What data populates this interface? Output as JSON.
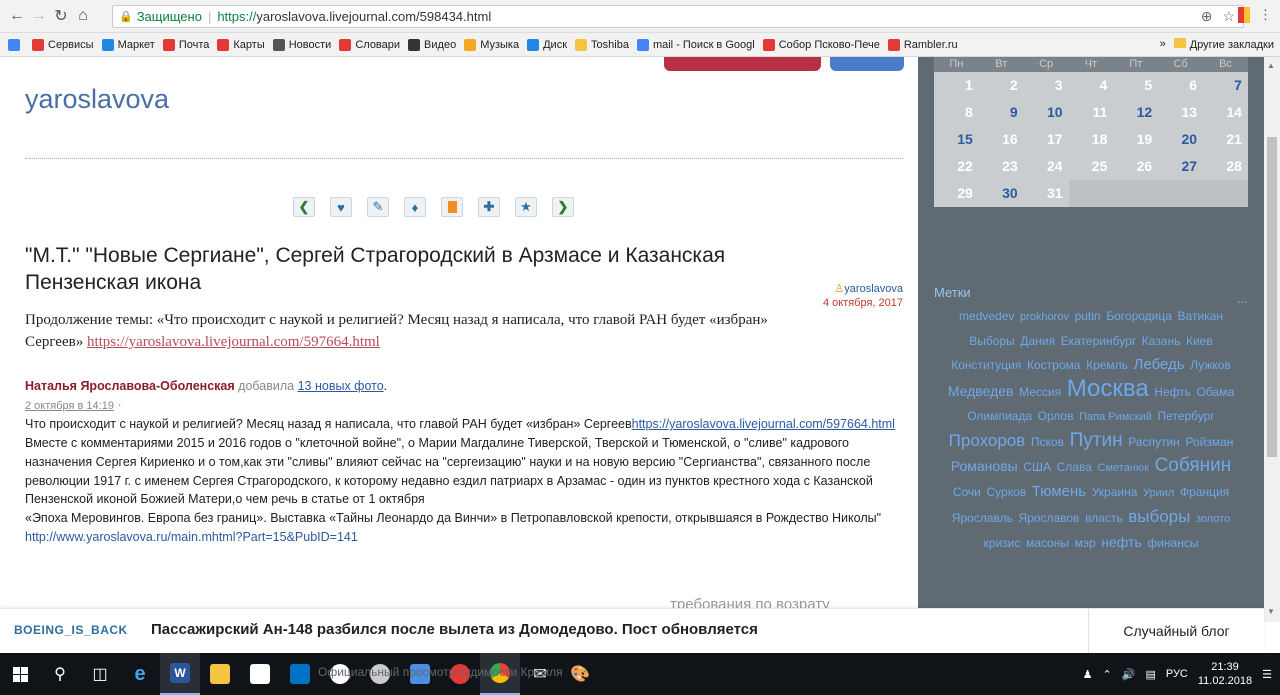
{
  "browser": {
    "secure_label": "Защищено",
    "url_scheme": "https://",
    "url_rest": "yaroslavova.livejournal.com/598434.html",
    "bookmarks": [
      {
        "label": "Сервисы",
        "color": "#e53935"
      },
      {
        "label": "Маркет",
        "color": "#1e88e5"
      },
      {
        "label": "Почта",
        "color": "#e53935"
      },
      {
        "label": "Карты",
        "color": "#e53935"
      },
      {
        "label": "Новости",
        "color": "#555555"
      },
      {
        "label": "Словари",
        "color": "#e53935"
      },
      {
        "label": "Видео",
        "color": "#333333"
      },
      {
        "label": "Музыка",
        "color": "#f5a623"
      },
      {
        "label": "Диск",
        "color": "#1e88e5"
      },
      {
        "label": "Toshiba",
        "color": "#f5c542"
      },
      {
        "label": "mail - Поиск в Googl",
        "color": "#4285f4"
      },
      {
        "label": "Собор Псково-Пече",
        "color": "#e53935"
      },
      {
        "label": "Rambler.ru",
        "color": "#e53935"
      }
    ],
    "other_bookmarks": "Другие закладки"
  },
  "blog": {
    "name": "yaroslavova",
    "post_title": "\"М.Т.\" \"Новые Сергиане\", Сергей Страгородский в Арзмасе и Казанская Пензенская икона",
    "author": "yaroslavova",
    "date": "4 октября, 2017",
    "lead_text": "Продолжение темы:   «Что происходит с наукой и религией? Месяц назад я написала, что главой РАН будет «избран» Сергеев» ",
    "lead_link": "https://yaroslavova.livejournal.com/597664.html",
    "fb": {
      "author": "Наталья Ярославова-Оболенская",
      "added": "добавила",
      "photos": "13 новых фото",
      "period": ".",
      "timestamp": "2 октября в 14:19",
      "dot": "·",
      "p1": "Что происходит с наукой и религией? Месяц назад я написала,  что главой РАН будет «избран» Сергеев",
      "p1_link": "https://yaroslavova.livejournal.com/597664.html",
      "p2": "Вместе с комментариями 2015 и 2016 годов о \"клеточной войне\", о Марии Магдалине Тиверской, Тверской и Тюменской, о \"сливе\" кадрового назначения Сергея Кириенко и о том,как эти \"сливы\" влияют сейчас на \"сергеизацию\" науки и на новую версию \"Сергианства\", связанного после революции 1917 г. с именем Сергея Страгородского, к которому недавно ездил патриарх в Арзамас - один из пунктов крестного хода с Казанской Пензенской иконой Божией Матери,о чем речь в статье от 1 октября",
      "p3": "«Эпоха Меровингов. Европа без границ». Выставка «Тайны Леонардо да Винчи» в Петропавловской крепости, открывшаяся в Рождество Николы\"",
      "p4_cut": "http://www.yaroslavova.ru/main.mhtml?Part=15&PubID=141"
    }
  },
  "calendar": {
    "headers": [
      "Пн",
      "Вт",
      "Ср",
      "Чт",
      "Пт",
      "Сб",
      "Вс"
    ],
    "rows": [
      [
        {
          "d": "1"
        },
        {
          "d": "2"
        },
        {
          "d": "3"
        },
        {
          "d": "4"
        },
        {
          "d": "5"
        },
        {
          "d": "6"
        },
        {
          "d": "7",
          "link": true
        }
      ],
      [
        {
          "d": "8"
        },
        {
          "d": "9",
          "link": true
        },
        {
          "d": "10",
          "link": true
        },
        {
          "d": "11"
        },
        {
          "d": "12",
          "link": true
        },
        {
          "d": "13"
        },
        {
          "d": "14"
        }
      ],
      [
        {
          "d": "15",
          "link": true
        },
        {
          "d": "16"
        },
        {
          "d": "17"
        },
        {
          "d": "18"
        },
        {
          "d": "19"
        },
        {
          "d": "20",
          "link": true
        },
        {
          "d": "21"
        }
      ],
      [
        {
          "d": "22"
        },
        {
          "d": "23"
        },
        {
          "d": "24"
        },
        {
          "d": "25"
        },
        {
          "d": "26"
        },
        {
          "d": "27",
          "link": true
        },
        {
          "d": "28"
        }
      ],
      [
        {
          "d": "29"
        },
        {
          "d": "30",
          "link": true
        },
        {
          "d": "31"
        },
        {
          "d": ""
        },
        {
          "d": ""
        },
        {
          "d": ""
        },
        {
          "d": ""
        }
      ]
    ]
  },
  "tags": {
    "title": "Метки",
    "more": "...",
    "items": [
      {
        "t": "medvedev",
        "s": 12
      },
      {
        "t": "prokhorov",
        "s": 11
      },
      {
        "t": "putin",
        "s": 12
      },
      {
        "t": "Богородица",
        "s": 12
      },
      {
        "t": "Ватикан",
        "s": 12
      },
      {
        "t": "Выборы",
        "s": 12
      },
      {
        "t": "Дания",
        "s": 12
      },
      {
        "t": "Екатеринбург",
        "s": 12
      },
      {
        "t": "Казань",
        "s": 12
      },
      {
        "t": "Киев",
        "s": 12
      },
      {
        "t": "Конституция",
        "s": 12
      },
      {
        "t": "Кострома",
        "s": 12
      },
      {
        "t": "Кремль",
        "s": 12
      },
      {
        "t": "Лебедь",
        "s": 15
      },
      {
        "t": "Лужков",
        "s": 12
      },
      {
        "t": "Медведев",
        "s": 14
      },
      {
        "t": "Мессия",
        "s": 12
      },
      {
        "t": "Москва",
        "s": 24
      },
      {
        "t": "Нефть",
        "s": 12
      },
      {
        "t": "Обама",
        "s": 12
      },
      {
        "t": "Олимпиада",
        "s": 12
      },
      {
        "t": "Орлов",
        "s": 12
      },
      {
        "t": "Папа Римский",
        "s": 11
      },
      {
        "t": "Петербург",
        "s": 12
      },
      {
        "t": "Прохоров",
        "s": 17
      },
      {
        "t": "Псков",
        "s": 12
      },
      {
        "t": "Путин",
        "s": 19
      },
      {
        "t": "Распутин",
        "s": 12
      },
      {
        "t": "Ройзман",
        "s": 12
      },
      {
        "t": "Романовы",
        "s": 14
      },
      {
        "t": "США",
        "s": 12
      },
      {
        "t": "Слава",
        "s": 12
      },
      {
        "t": "Сметанюк",
        "s": 11
      },
      {
        "t": "Собянин",
        "s": 19
      },
      {
        "t": "Сочи",
        "s": 12
      },
      {
        "t": "Сурков",
        "s": 12
      },
      {
        "t": "Тюмень",
        "s": 15
      },
      {
        "t": "Украина",
        "s": 12
      },
      {
        "t": "Уриил",
        "s": 11
      },
      {
        "t": "Франция",
        "s": 12
      },
      {
        "t": "Ярославль",
        "s": 12
      },
      {
        "t": "Ярославов",
        "s": 12
      },
      {
        "t": "власть",
        "s": 12
      },
      {
        "t": "выборы",
        "s": 17
      },
      {
        "t": "золото",
        "s": 11
      },
      {
        "t": "кризис",
        "s": 12
      },
      {
        "t": "масоны",
        "s": 12
      },
      {
        "t": "мэр",
        "s": 12
      },
      {
        "t": "нефть",
        "s": 14
      },
      {
        "t": "финансы",
        "s": 12
      }
    ]
  },
  "banner": {
    "tag": "BOEING_IS_BACK",
    "title": "Пассажирский Ан-148 разбился после вылета из Домодедово. Пост обновляется",
    "random": "Случайный блог"
  },
  "behind_text": "требования по возрату",
  "behind_text2": "Официальный просмотр судимости Кремля",
  "taskbar": {
    "lang": "РУС",
    "time": "21:39",
    "date": "11.02.2018"
  }
}
